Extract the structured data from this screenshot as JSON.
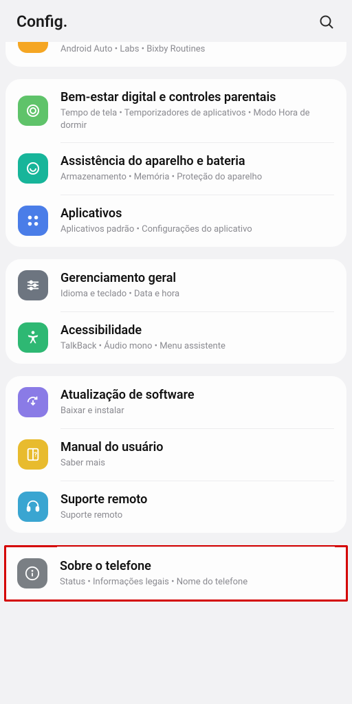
{
  "header": {
    "title": "Config."
  },
  "groups": [
    {
      "cropped": true,
      "items": [
        {
          "id": "android-auto",
          "icon": "orange",
          "title": "",
          "sub": "Android Auto  •  Labs  •  Bixby Routines"
        }
      ]
    },
    {
      "items": [
        {
          "id": "digital-wellbeing",
          "icon": "green1",
          "title": "Bem-estar digital e controles parentais",
          "sub": "Tempo de tela  •  Temporizadores de aplicativos  •  Modo Hora de dormir"
        },
        {
          "id": "device-care",
          "icon": "teal",
          "title": "Assistência do aparelho e bateria",
          "sub": "Armazenamento  •  Memória  •  Proteção do aparelho"
        },
        {
          "id": "apps",
          "icon": "blue",
          "title": "Aplicativos",
          "sub": "Aplicativos padrão  •  Configurações do aplicativo"
        }
      ]
    },
    {
      "items": [
        {
          "id": "general-management",
          "icon": "gray",
          "title": "Gerenciamento geral",
          "sub": "Idioma e teclado  •  Data e hora"
        },
        {
          "id": "accessibility",
          "icon": "greenA",
          "title": "Acessibilidade",
          "sub": "TalkBack  •  Áudio mono  •  Menu assistente"
        }
      ]
    },
    {
      "items": [
        {
          "id": "software-update",
          "icon": "purple",
          "title": "Atualização de software",
          "sub": "Baixar e instalar"
        },
        {
          "id": "user-manual",
          "icon": "yellow",
          "title": "Manual do usuário",
          "sub": "Saber mais"
        },
        {
          "id": "remote-support",
          "icon": "cyan",
          "title": "Suporte remoto",
          "sub": "Suporte remoto"
        }
      ]
    }
  ],
  "highlighted": {
    "id": "about-phone",
    "icon": "gray2",
    "title": "Sobre o telefone",
    "sub": "Status  •  Informações legais  •  Nome do telefone"
  }
}
